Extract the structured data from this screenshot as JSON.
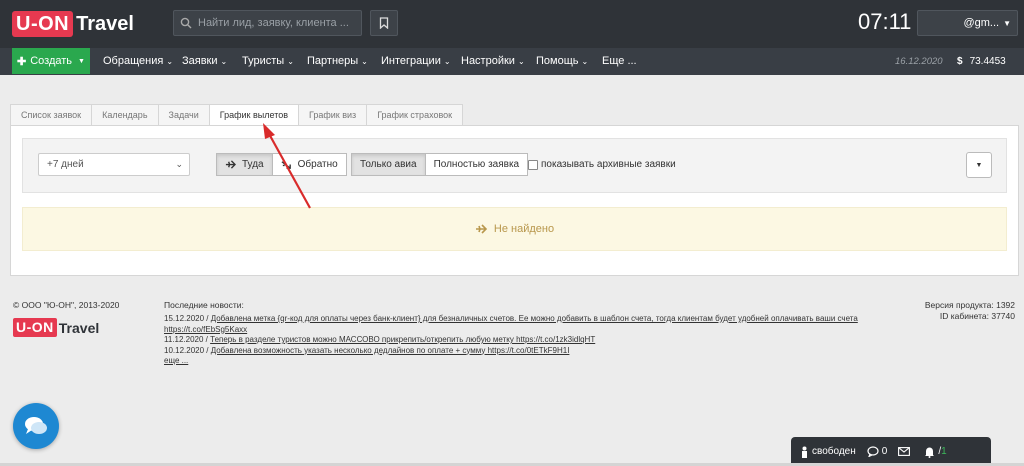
{
  "header": {
    "logo_badge": "U-ON",
    "logo_word": "Travel",
    "search_placeholder": "Найти лид, заявку, клиента ...",
    "clock": "07:11",
    "user": "@gm..."
  },
  "nav": {
    "create_label": "Создать",
    "items": [
      "Обращения",
      "Заявки",
      "Туристы",
      "Партнеры",
      "Интеграции",
      "Настройки",
      "Помощь",
      "Еще ..."
    ],
    "date": "16.12.2020",
    "currency_symbol": "$",
    "rate": "73.4453"
  },
  "tabs": [
    "Список заявок",
    "Календарь",
    "Задачи",
    "График вылетов",
    "График виз",
    "График страховок"
  ],
  "active_tab": "График вылетов",
  "filter": {
    "period_value": "+7 дней",
    "direction": [
      "Туда",
      "Обратно"
    ],
    "mode": [
      "Только авиа",
      "Полностью заявка"
    ],
    "archive_label": "показывать архивные заявки"
  },
  "empty_message": "Не найдено",
  "footer": {
    "copyright": "© ООО \"Ю-ОН\", 2013-2020",
    "logo_badge": "U-ON",
    "logo_word": "Travel",
    "news_title": "Последние новости:",
    "news": [
      {
        "date": "15.12.2020 /",
        "text": "Добавлена метка {qr-код для оплаты через банк-клиент} для безналичных счетов. Ее можно добавить в шаблон счета, тогда клиентам будет удобней оплачивать ваши счета https://t.co/fEbSg5Kaxx"
      },
      {
        "date": "11.12.2020 /",
        "text": "Теперь в разделе туристов можно МАССОВО прикрепить/открепить любую метку https://t.co/1zk3idlqHT"
      },
      {
        "date": "10.12.2020 /",
        "text": "Добавлена возможность указать несколько дедлайнов по оплате + сумму https://t.co/0tETkF9H1I"
      }
    ],
    "news_more": "еще ...",
    "version_label": "Версия продукта: 1392",
    "cabinet_id": "ID кабинета: 37740"
  },
  "statusbar": {
    "status": "свободен",
    "chats": "0",
    "notifications_a": "",
    "notifications_sep": "/",
    "notifications_b": "1"
  },
  "colors": {
    "brand": "#e63950",
    "header_bg": "#2f3338",
    "create_green": "#2aa84e",
    "empty_bg": "#fcf8e3",
    "chat_blue": "#1e88d2"
  }
}
